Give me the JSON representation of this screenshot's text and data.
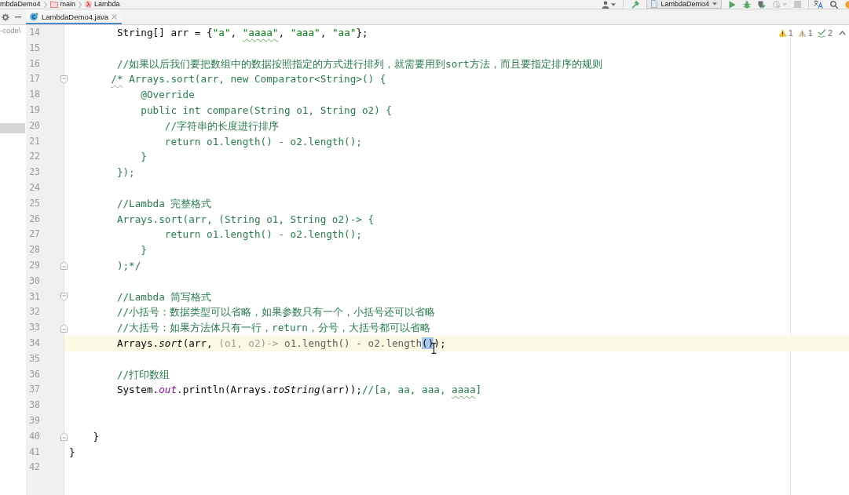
{
  "toolbar": {
    "breadcrumbs": [
      {
        "label": "mbdaDemo4",
        "kind": "project"
      },
      {
        "label": "main",
        "kind": "module"
      },
      {
        "label": "Lambda",
        "kind": "class"
      }
    ],
    "vcs_actions": [
      {
        "kind": "user",
        "disabled": false,
        "dropdown": true
      },
      {
        "kind": "build",
        "disabled": false,
        "dropdown": false
      }
    ],
    "run_configuration": {
      "label": "LambdaDemo4"
    },
    "run_actions": [
      {
        "kind": "run",
        "disabled": false,
        "dropdown": false
      },
      {
        "kind": "debug",
        "disabled": false,
        "dropdown": false
      },
      {
        "kind": "coverage",
        "disabled": false,
        "dropdown": false
      },
      {
        "kind": "profile",
        "disabled": true,
        "dropdown": true
      },
      {
        "kind": "stop",
        "disabled": true,
        "dropdown": false
      }
    ],
    "tool_actions": [
      {
        "kind": "translate",
        "disabled": false,
        "dropdown": false
      },
      {
        "kind": "search",
        "disabled": false,
        "dropdown": false
      },
      {
        "kind": "notification",
        "disabled": false,
        "dropdown": false
      }
    ]
  },
  "panel_header": {
    "actions": [
      {
        "kind": "settings"
      },
      {
        "kind": "hide"
      }
    ]
  },
  "editor_tabs": [
    {
      "label": "LambdaDemo4.java",
      "selected": true
    }
  ],
  "project_panel": {
    "path": "-code\\",
    "row_highlighted": true
  },
  "inspections": [
    {
      "kind": "warning",
      "count": "1"
    },
    {
      "kind": "weak-warning",
      "count": "1"
    },
    {
      "kind": "typo",
      "count": "2"
    }
  ],
  "editor": {
    "pointer": {
      "kind": "i-beam"
    },
    "lines": [
      {
        "number": "14",
        "current": false,
        "segments": [
          {
            "text": "        String[] arr = {",
            "kind": "plain"
          },
          {
            "text": "\"a\"",
            "kind": "string"
          },
          {
            "text": ", ",
            "kind": "plain"
          },
          {
            "text": "\"aaaa\"",
            "kind": "string-typo"
          },
          {
            "text": ", ",
            "kind": "plain"
          },
          {
            "text": "\"aaa\"",
            "kind": "string"
          },
          {
            "text": ", ",
            "kind": "plain"
          },
          {
            "text": "\"aa\"",
            "kind": "string"
          },
          {
            "text": "};",
            "kind": "plain"
          }
        ]
      },
      {
        "number": "15",
        "current": false
      },
      {
        "number": "16",
        "current": false,
        "segments": [
          {
            "text": "        //如果以后我们要把数组中的数据按照指定的方式进行排列，就需要用到sort方法，而且要指定排序的规则",
            "kind": "comment"
          }
        ]
      },
      {
        "number": "17",
        "current": false,
        "fold": {
          "kind": "start"
        },
        "segments": [
          {
            "text": "       /*",
            "kind": "comment-warning"
          },
          {
            "text": " Arrays.sort(arr, new Comparator<String>() {",
            "kind": "comment"
          }
        ]
      },
      {
        "number": "18",
        "current": false,
        "segments": [
          {
            "text": "            @Override",
            "kind": "comment"
          }
        ]
      },
      {
        "number": "19",
        "current": false,
        "segments": [
          {
            "text": "            public int compare(String o1, String o2) {",
            "kind": "comment"
          }
        ]
      },
      {
        "number": "20",
        "current": false,
        "segments": [
          {
            "text": "                //字符串的长度进行排序",
            "kind": "comment"
          }
        ]
      },
      {
        "number": "21",
        "current": false,
        "segments": [
          {
            "text": "                return o1.length() - o2.length();",
            "kind": "comment"
          }
        ]
      },
      {
        "number": "22",
        "current": false,
        "segments": [
          {
            "text": "            }",
            "kind": "comment"
          }
        ]
      },
      {
        "number": "23",
        "current": false,
        "segments": [
          {
            "text": "        });",
            "kind": "comment"
          }
        ]
      },
      {
        "number": "24",
        "current": false
      },
      {
        "number": "25",
        "current": false,
        "segments": [
          {
            "text": "        //Lambda 完整格式",
            "kind": "comment"
          }
        ]
      },
      {
        "number": "26",
        "current": false,
        "segments": [
          {
            "text": "        Arrays.sort(arr, (String o1, String o2)-> {",
            "kind": "comment"
          }
        ]
      },
      {
        "number": "27",
        "current": false,
        "segments": [
          {
            "text": "                return o1.length() - o2.length();",
            "kind": "comment"
          }
        ]
      },
      {
        "number": "28",
        "current": false,
        "segments": [
          {
            "text": "            }",
            "kind": "comment"
          }
        ]
      },
      {
        "number": "29",
        "current": false,
        "fold": {
          "kind": "end"
        },
        "segments": [
          {
            "text": "        );*/",
            "kind": "comment"
          }
        ]
      },
      {
        "number": "30",
        "current": false
      },
      {
        "number": "31",
        "current": false,
        "fold": {
          "kind": "start"
        },
        "segments": [
          {
            "text": "        //Lambda 简写格式",
            "kind": "comment"
          }
        ]
      },
      {
        "number": "32",
        "current": false,
        "segments": [
          {
            "text": "        //小括号：数据类型可以省略，如果参数只有一个，小括号还可以省略",
            "kind": "comment"
          }
        ]
      },
      {
        "number": "33",
        "current": false,
        "fold": {
          "kind": "end"
        },
        "segments": [
          {
            "text": "        //大括号：如果方法体只有一行，return，分号，大括号都可以省略",
            "kind": "comment"
          }
        ]
      },
      {
        "number": "34",
        "current": true,
        "segments": [
          {
            "text": "        Arrays.",
            "kind": "plain"
          },
          {
            "text": "sort",
            "kind": "method"
          },
          {
            "text": "(arr, ",
            "kind": "plain"
          },
          {
            "text": "(o1, o2)->",
            "kind": "faded"
          },
          {
            "text": " o1.length() - o2.length",
            "kind": "dim"
          },
          {
            "text": "()",
            "kind": "selection"
          },
          {
            "text": ");",
            "kind": "plain"
          }
        ]
      },
      {
        "number": "35",
        "current": false
      },
      {
        "number": "36",
        "current": false,
        "segments": [
          {
            "text": "        //打印数组",
            "kind": "comment"
          }
        ]
      },
      {
        "number": "37",
        "current": false,
        "segments": [
          {
            "text": "        System.",
            "kind": "plain"
          },
          {
            "text": "out",
            "kind": "field"
          },
          {
            "text": ".println(Arrays.",
            "kind": "plain"
          },
          {
            "text": "toString",
            "kind": "method"
          },
          {
            "text": "(arr));",
            "kind": "plain"
          },
          {
            "text": "//[a, aa, aaa, ",
            "kind": "comment"
          },
          {
            "text": "aaaa",
            "kind": "comment-typo"
          },
          {
            "text": "]",
            "kind": "comment"
          }
        ]
      },
      {
        "number": "38",
        "current": false
      },
      {
        "number": "39",
        "current": false
      },
      {
        "number": "40",
        "current": false,
        "fold": {
          "kind": "end"
        },
        "segments": [
          {
            "text": "    }",
            "kind": "plain"
          }
        ]
      },
      {
        "number": "41",
        "current": false,
        "segments": [
          {
            "text": "}",
            "kind": "plain"
          }
        ]
      },
      {
        "number": "42",
        "current": false
      }
    ]
  }
}
